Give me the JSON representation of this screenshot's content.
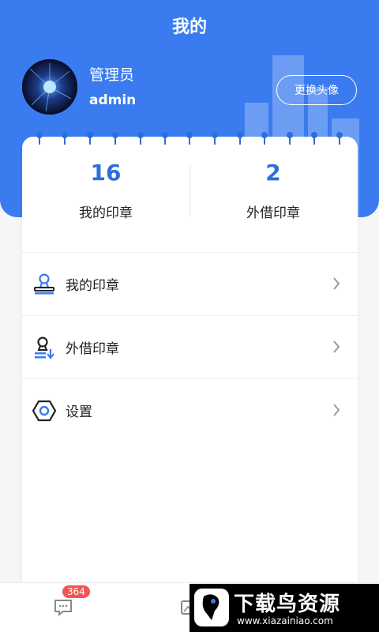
{
  "header": {
    "title": "我的",
    "role_name": "管理员",
    "username": "admin",
    "change_avatar_label": "更换头像"
  },
  "stats": [
    {
      "value": "16",
      "label": "我的印章"
    },
    {
      "value": "2",
      "label": "外借印章"
    }
  ],
  "menu": [
    {
      "label": "我的印章",
      "icon": "stamp-icon"
    },
    {
      "label": "外借印章",
      "icon": "stamp-lend-icon"
    },
    {
      "label": "设置",
      "icon": "settings-hex-icon"
    }
  ],
  "tabbar": {
    "message_badge": "364"
  },
  "watermark": {
    "title": "下载鸟资源",
    "url": "www.xiazainiao.com"
  },
  "colors": {
    "primary": "#3a7cf0",
    "stat_number": "#2c6fd8",
    "badge": "#f25555"
  }
}
